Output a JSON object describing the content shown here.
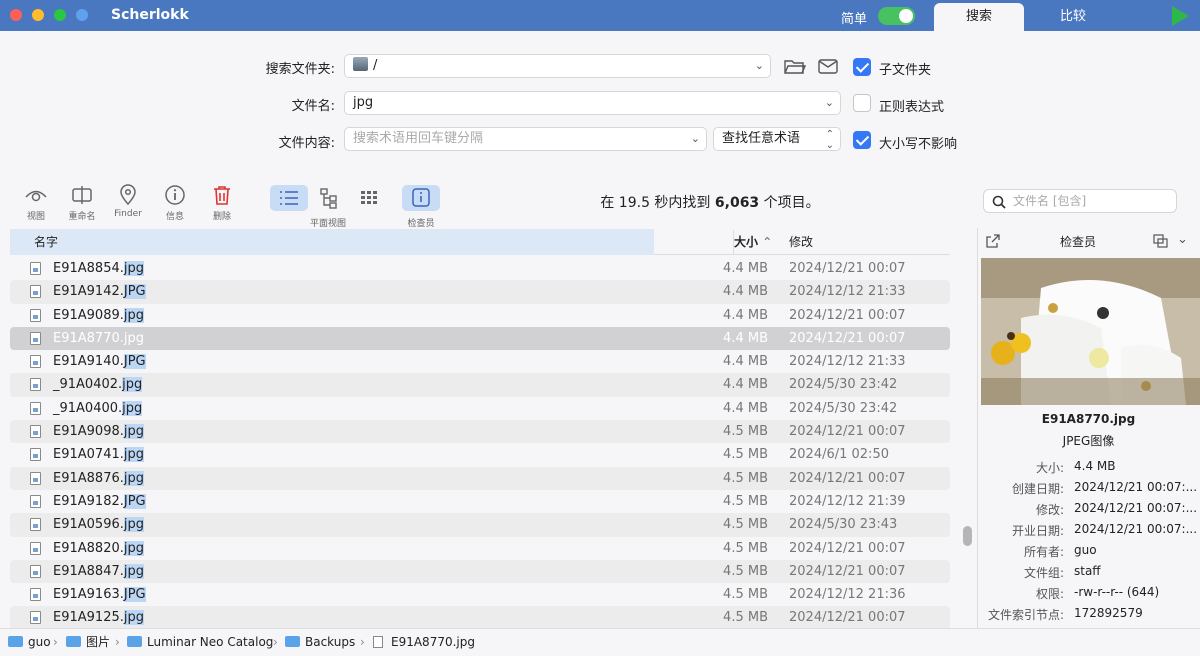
{
  "app": {
    "title": "Scherlokk",
    "mode_label": "简单",
    "tabs": [
      "搜索",
      "比较"
    ]
  },
  "form": {
    "folder_label": "搜索文件夹:",
    "folder_value": "/",
    "filename_label": "文件名:",
    "filename_value": "jpg",
    "content_label": "文件内容:",
    "content_placeholder": "搜索术语用回车键分隔",
    "match_mode": "查找任意术语",
    "subfolders_label": "子文件夹",
    "subfolders_checked": true,
    "regex_label": "正则表达式",
    "regex_checked": false,
    "case_label": "大小写不影响",
    "case_checked": true
  },
  "toolbar": {
    "view_label": "视图",
    "rename_label": "重命名",
    "finder_label": "Finder",
    "info_label": "信息",
    "delete_label": "删除",
    "flat_view_label": "平面视图",
    "inspector_label": "检查员",
    "search_placeholder": "文件名 [包含]"
  },
  "result": {
    "prefix": "在 19.5 秒内找到 ",
    "count": "6,063",
    "suffix": " 个项目。"
  },
  "columns": {
    "name": "名字",
    "size": "大小",
    "size_sort": "^",
    "modified": "修改"
  },
  "files": [
    {
      "base": "E91A8854.",
      "ext": "jpg",
      "size": "4.4 MB",
      "date": "2024/12/21 00:07"
    },
    {
      "base": "E91A9142.",
      "ext": "JPG",
      "size": "4.4 MB",
      "date": "2024/12/12 21:33"
    },
    {
      "base": "E91A9089.",
      "ext": "jpg",
      "size": "4.4 MB",
      "date": "2024/12/21 00:07"
    },
    {
      "base": "E91A8770.",
      "ext": "jpg",
      "size": "4.4 MB",
      "date": "2024/12/21 00:07"
    },
    {
      "base": "E91A9140.",
      "ext": "JPG",
      "size": "4.4 MB",
      "date": "2024/12/12 21:33"
    },
    {
      "base": "_91A0402.",
      "ext": "jpg",
      "size": "4.4 MB",
      "date": "2024/5/30 23:42"
    },
    {
      "base": "_91A0400.",
      "ext": "jpg",
      "size": "4.4 MB",
      "date": "2024/5/30 23:42"
    },
    {
      "base": "E91A9098.",
      "ext": "jpg",
      "size": "4.5 MB",
      "date": "2024/12/21 00:07"
    },
    {
      "base": "E91A0741.",
      "ext": "jpg",
      "size": "4.5 MB",
      "date": "2024/6/1 02:50"
    },
    {
      "base": "E91A8876.",
      "ext": "jpg",
      "size": "4.5 MB",
      "date": "2024/12/21 00:07"
    },
    {
      "base": "E91A9182.",
      "ext": "JPG",
      "size": "4.5 MB",
      "date": "2024/12/12 21:39"
    },
    {
      "base": "E91A0596.",
      "ext": "jpg",
      "size": "4.5 MB",
      "date": "2024/5/30 23:43"
    },
    {
      "base": "E91A8820.",
      "ext": "jpg",
      "size": "4.5 MB",
      "date": "2024/12/21 00:07"
    },
    {
      "base": "E91A8847.",
      "ext": "jpg",
      "size": "4.5 MB",
      "date": "2024/12/21 00:07"
    },
    {
      "base": "E91A9163.",
      "ext": "JPG",
      "size": "4.5 MB",
      "date": "2024/12/12 21:36"
    },
    {
      "base": "E91A9125.",
      "ext": "jpg",
      "size": "4.5 MB",
      "date": "2024/12/21 00:07"
    }
  ],
  "inspector": {
    "title": "检查员",
    "file_name": "E91A8770.jpg",
    "file_type": "JPEG图像",
    "props": [
      {
        "k": "大小:",
        "v": "4.4 MB"
      },
      {
        "k": "创建日期:",
        "v": "2024/12/21 00:07:..."
      },
      {
        "k": "修改:",
        "v": "2024/12/21 00:07:..."
      },
      {
        "k": "开业日期:",
        "v": "2024/12/21 00:07:..."
      },
      {
        "k": "所有者:",
        "v": "guo"
      },
      {
        "k": "文件组:",
        "v": "staff"
      },
      {
        "k": "权限:",
        "v": "-rw-r--r-- (644)"
      },
      {
        "k": "文件索引节点:",
        "v": "172892579"
      }
    ]
  },
  "breadcrumb": [
    "guo",
    "图片",
    "Luminar Neo Catalog",
    "Backups",
    "E91A8770.jpg"
  ]
}
